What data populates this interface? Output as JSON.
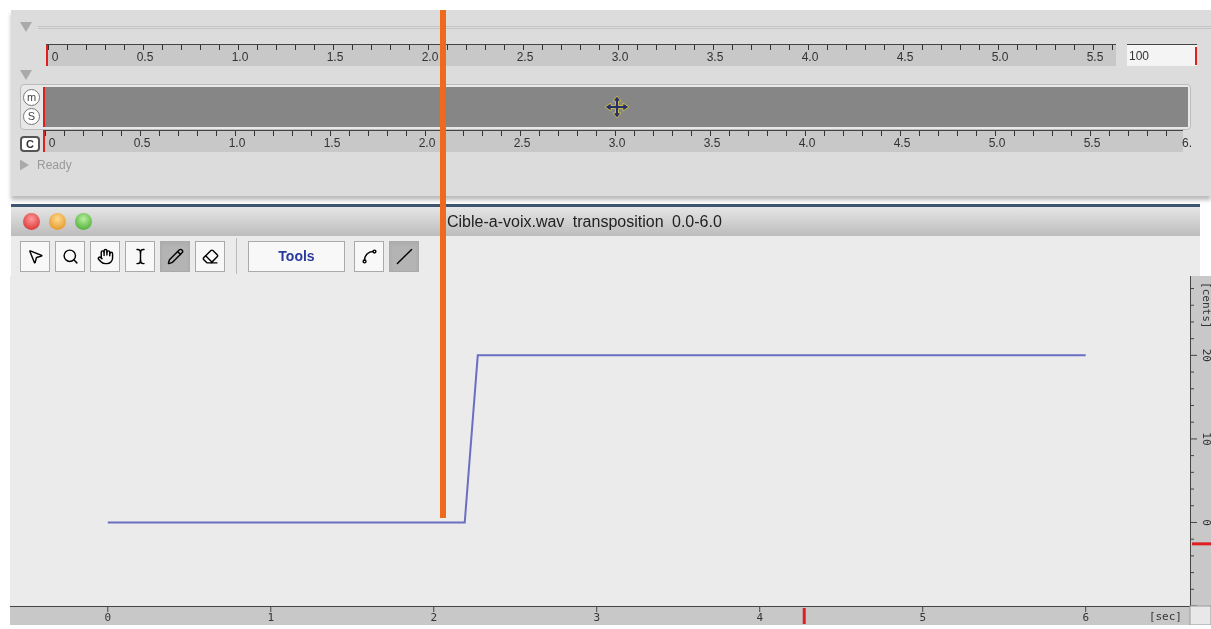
{
  "top_panel": {
    "ruler_1": {
      "labels": [
        "0",
        "0.5",
        "1.0",
        "1.5",
        "2.0",
        "2.5",
        "3.0",
        "3.5",
        "4.0",
        "4.5",
        "5.0",
        "5.5"
      ]
    },
    "zoom_box": {
      "value": "100"
    },
    "track": {
      "buttons": [
        "m",
        "S"
      ]
    },
    "ruler_2": {
      "button": "C",
      "labels": [
        "0",
        "0.5",
        "1.0",
        "1.5",
        "2.0",
        "2.5",
        "3.0",
        "3.5",
        "4.0",
        "4.5",
        "5.0",
        "5.5",
        "6."
      ]
    },
    "status": "Ready"
  },
  "window": {
    "title": "Cible-a-voix.wav transposition 0.0-6.0"
  },
  "toolbar": {
    "tools": [
      {
        "kind": "arrow",
        "selected": false
      },
      {
        "kind": "zoom",
        "selected": false
      },
      {
        "kind": "hand",
        "selected": false
      },
      {
        "kind": "text",
        "selected": false
      },
      {
        "kind": "pencil",
        "selected": true
      },
      {
        "kind": "eraser",
        "selected": false
      }
    ],
    "palette_label": "Tools",
    "modes": [
      {
        "kind": "points",
        "selected": false
      },
      {
        "kind": "line",
        "selected": true
      }
    ]
  },
  "plot": {
    "chart_data": {
      "type": "line",
      "xlabel": "[sec]",
      "ylabel": "[cents]",
      "x": [
        0,
        2.19,
        2.27,
        6.0
      ],
      "series": [
        {
          "color": "#6b6fc4",
          "values": [
            0,
            0,
            20,
            20
          ]
        }
      ],
      "xlim": [
        -0.6,
        6.64
      ],
      "ylim": [
        -10,
        29.5
      ],
      "xticks": [
        0,
        1,
        2,
        3,
        4,
        5,
        6
      ],
      "yticks": [
        0,
        10,
        20
      ]
    }
  }
}
